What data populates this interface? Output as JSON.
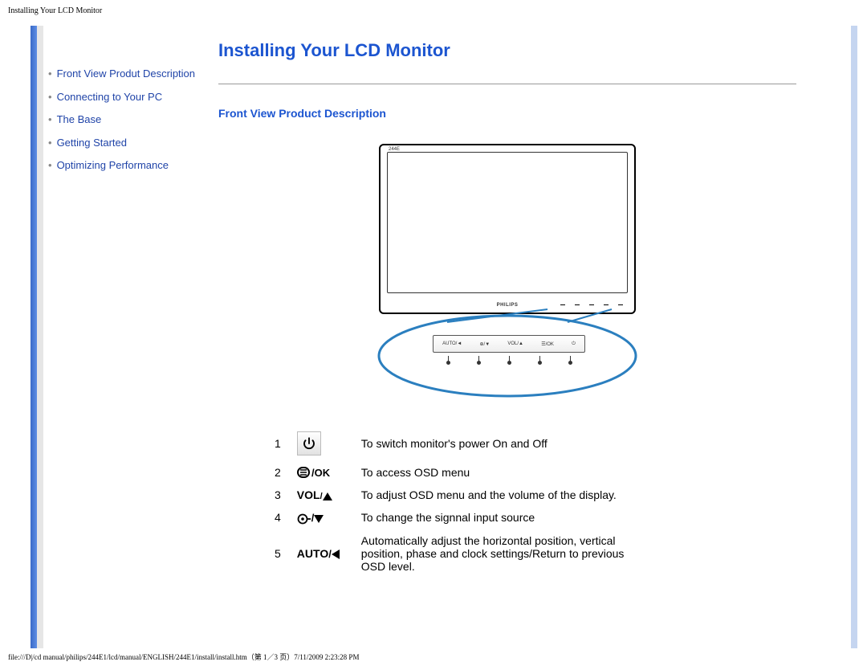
{
  "header_text": "Installing Your LCD Monitor",
  "footer_text": "file:///D|/cd manual/philips/244E1/lcd/manual/ENGLISH/244E1/install/install.htm（第 1／3 页）7/11/2009 2:23:28 PM",
  "sidebar": {
    "items": [
      {
        "label": "Front View Produt Description"
      },
      {
        "label": "Connecting to Your PC"
      },
      {
        "label": "The Base"
      },
      {
        "label": "Getting Started"
      },
      {
        "label": "Optimizing Performance"
      }
    ]
  },
  "page_title": "Installing Your LCD Monitor",
  "section_heading": "Front View Product Description",
  "monitor": {
    "brand": "PHILIPS",
    "model": "244E"
  },
  "panel_labels": [
    "AUTO/◄",
    "⊕/▼",
    "VOL/▲",
    "☰/OK",
    "⏻"
  ],
  "button_table": {
    "rows": [
      {
        "num": "1",
        "sym_type": "power",
        "desc": "To switch monitor's power On and Off"
      },
      {
        "num": "2",
        "sym_type": "menu_ok",
        "desc": "To access OSD menu"
      },
      {
        "num": "3",
        "sym_type": "vol_up",
        "sym_text": "VOL/▲",
        "desc": "To adjust OSD menu and the volume of the display."
      },
      {
        "num": "4",
        "sym_type": "input_down",
        "desc": "To change the signnal input source"
      },
      {
        "num": "5",
        "sym_type": "auto_left",
        "sym_text": "AUTO/◄",
        "desc": "Automatically adjust the horizontal position, vertical position, phase    and clock settings/Return to previous OSD level."
      }
    ]
  }
}
